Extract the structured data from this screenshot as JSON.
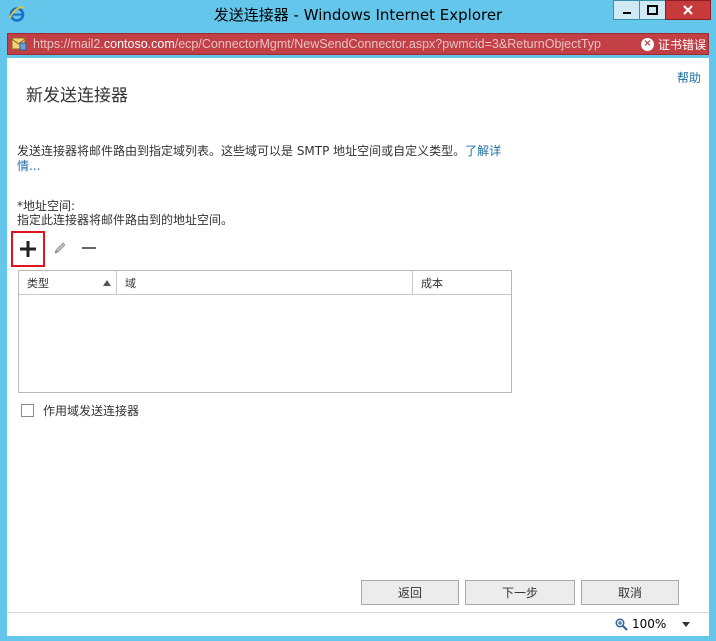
{
  "window": {
    "title": "发送连接器 - Windows Internet Explorer",
    "controls": [
      "minimize",
      "maximize",
      "close"
    ]
  },
  "address_bar": {
    "url_prefix": "https://mail2.",
    "url_host": "contoso.com",
    "url_rest": "/ecp/ConnectorMgmt/NewSendConnector.aspx?pwmcid=3&ReturnObjectTyp",
    "cert_error": "证书错误"
  },
  "page": {
    "help": "帮助",
    "title": "新发送连接器",
    "description": "发送连接器将邮件路由到指定域列表。这些域可以是 SMTP 地址空间或自定义类型。",
    "learn_more": "了解详情...",
    "field_label": "*地址空间:",
    "field_hint": "指定此连接器将邮件路由到的地址空间。",
    "toolbar": {
      "add_icon": "plus-icon",
      "edit_icon": "pencil-icon",
      "remove_icon": "minus-icon"
    },
    "grid": {
      "columns": [
        "类型",
        "域",
        "成本"
      ],
      "rows": []
    },
    "scoped_checkbox": {
      "label": "作用域发送连接器",
      "checked": false
    }
  },
  "buttons": {
    "back": "返回",
    "next": "下一步",
    "cancel": "取消"
  },
  "status_bar": {
    "zoom": "100%"
  },
  "colors": {
    "window_frame": "#63c6ea",
    "address_bar_error": "#c13f45",
    "link": "#1e6ea6",
    "highlight_box": "#e0141e"
  }
}
